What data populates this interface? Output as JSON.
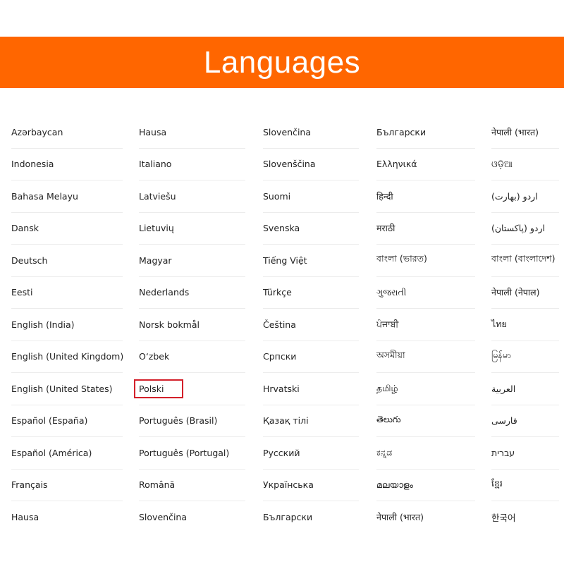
{
  "header": {
    "title": "Languages"
  },
  "colors": {
    "accent": "#ff6600",
    "selection": "#d3202a"
  },
  "selected_language": "Polski",
  "columns": [
    [
      "Azərbaycan",
      "Indonesia",
      "Bahasa Melayu",
      "Dansk",
      "Deutsch",
      "Eesti",
      "English (India)",
      "English (United Kingdom)",
      "English (United States)",
      "Español (España)",
      "Español (América)",
      "Français",
      "Hausa"
    ],
    [
      "Hausa",
      "Italiano",
      "Latviešu",
      "Lietuvių",
      "Magyar",
      "Nederlands",
      "Norsk bokmål",
      "O‘zbek",
      "Polski",
      "Português (Brasil)",
      "Português (Portugal)",
      "Română",
      "Slovenčina"
    ],
    [
      "Slovenčina",
      "Slovenščina",
      "Suomi",
      "Svenska",
      "Tiếng Việt",
      "Türkçe",
      "Čeština",
      "Српски",
      "Hrvatski",
      "Қазақ тілі",
      "Русский",
      "Українська",
      "Български"
    ],
    [
      "Български",
      "Ελληνικά",
      "हिन्दी",
      "मराठी",
      "বাংলা (ভারত)",
      "ગુજરાતી",
      "ਪੰਜਾਬੀ",
      "অসমীয়া",
      "தமிழ்",
      "తెలుగు",
      "ಕನ್ನಡ",
      "മലയാളം",
      "नेपाली (भारत)"
    ],
    [
      "नेपाली (भारत)",
      "ଓଡ଼ିଆ",
      "اردو (بھارت)",
      "اردو (پاکستان)",
      "বাংলা (বাংলাদেশ)",
      "नेपाली (नेपाल)",
      "ไทย",
      "မြန်မာ",
      "العربية",
      "فارسی",
      "עברית",
      "ខ្មែរ",
      "한국어"
    ]
  ]
}
